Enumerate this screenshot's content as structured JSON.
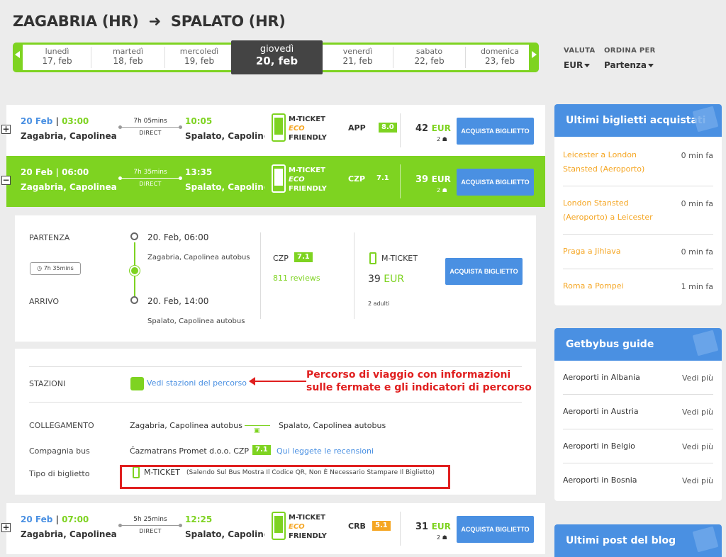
{
  "header": {
    "from": "ZAGABRIA (HR)",
    "arrow": "➜",
    "to": "SPALATO (HR)",
    "days": [
      {
        "name": "lunedì",
        "date": "17, feb"
      },
      {
        "name": "martedì",
        "date": "18, feb"
      },
      {
        "name": "mercoledì",
        "date": "19, feb"
      },
      {
        "name": "giovedì",
        "date": "20, feb",
        "active": true
      },
      {
        "name": "venerdì",
        "date": "21, feb"
      },
      {
        "name": "sabato",
        "date": "22, feb"
      },
      {
        "name": "domenica",
        "date": "23, feb"
      }
    ],
    "currency_label": "VALUTA",
    "currency_value": "EUR",
    "sort_label": "ORDINA PER",
    "sort_value": "Partenza"
  },
  "trips": [
    {
      "toggle": "+",
      "date": "20 Feb",
      "sep": " | ",
      "dep_time": "03:00",
      "dep_place": "Zagabria, Capolinea au...",
      "duration": "7h 05mins",
      "direct": "DIRECT",
      "arr_time": "10:05",
      "arr_place": "Spalato, Capolinea ...",
      "mticket": "M-TICKET",
      "eco": "ECO",
      "friendly": "FRIENDLY",
      "company": "APP",
      "rating": "8.0",
      "price": "42",
      "currency": "EUR",
      "pax": "2",
      "buy": "ACQUISTA BIGLIETTO"
    },
    {
      "toggle": "−",
      "date": "20 Feb",
      "sep": " | ",
      "dep_time": "06:00",
      "dep_place": "Zagabria, Capolinea au...",
      "duration": "7h 35mins",
      "direct": "DIRECT",
      "arr_time": "13:35",
      "arr_place": "Spalato, Capolinea ...",
      "mticket": "M-TICKET",
      "eco": "ECO",
      "friendly": "FRIENDLY",
      "company": "CZP",
      "rating": "7.1",
      "price": "39",
      "currency": "EUR",
      "pax": "2",
      "buy": "ACQUISTA BIGLIETTO"
    },
    {
      "toggle": "+",
      "date": "20 Feb",
      "sep": " | ",
      "dep_time": "07:00",
      "dep_place": "Zagabria, Capolinea au...",
      "duration": "5h 25mins",
      "direct": "DIRECT",
      "arr_time": "12:25",
      "arr_place": "Spalato, Capolinea ...",
      "mticket": "M-TICKET",
      "eco": "ECO",
      "friendly": "FRIENDLY",
      "company": "CRB",
      "rating": "5.1",
      "price": "31",
      "currency": "EUR",
      "pax": "2",
      "buy": "ACQUISTA BIGLIETTO"
    }
  ],
  "detail": {
    "partenza_label": "PARTENZA",
    "arrivo_label": "ARRIVO",
    "duration_badge": "7h 35mins",
    "dep_datetime": "20. Feb, 06:00",
    "dep_station": "Zagabria, Capolinea autobus",
    "arr_datetime": "20. Feb, 14:00",
    "arr_station": "Spalato, Capolinea autobus",
    "company": "CZP",
    "rating": "7.1",
    "reviews": "811 reviews",
    "mticket": "M-TICKET",
    "price": "39",
    "currency": "EUR",
    "adults": "2 adulti",
    "buy": "ACQUISTA BIGLIETTO",
    "stations_label": "STAZIONI",
    "stations_link": "Vedi stazioni del percorso",
    "connection_label": "COLLEGAMENTO",
    "connection_from": "Zagabria, Capolinea autobus",
    "connection_to": "Spalato, Capolinea autobus",
    "company_label": "Compagnia bus",
    "company_name": "Čazmatrans Promet d.o.o. CZP",
    "company_rating": "7.1",
    "reviews_link": "Qui leggete le recensioni",
    "ticket_type_label": "Tipo di biglietto",
    "ticket_type": "M-TICKET",
    "ticket_note": "(Salendo Sul Bus Mostra Il Codice QR, Non È Necessario Stampare Il Biglietto)"
  },
  "annotation": {
    "line1": "Percorso di viaggio con informazioni",
    "line2": "sulle fermate e gli indicatori di percorso"
  },
  "sidebar": {
    "recent_title": "Ultimi biglietti acquistati",
    "recent": [
      {
        "route": "Leicester a London Stansted (Aeroporto)",
        "time": "0 min fa"
      },
      {
        "route": "London Stansted (Aeroporto) a Leicester",
        "time": "0 min fa"
      },
      {
        "route": "Praga a Jihlava",
        "time": "0 min fa"
      },
      {
        "route": "Roma a Pompei",
        "time": "1 min fa"
      }
    ],
    "guide_title": "Getbybus guide",
    "guides": [
      {
        "name": "Aeroporti in Albania",
        "link": "Vedi più"
      },
      {
        "name": "Aeroporti in Austria",
        "link": "Vedi più"
      },
      {
        "name": "Aeroporti in Belgio",
        "link": "Vedi più"
      },
      {
        "name": "Aeroporti in Bosnia",
        "link": "Vedi più"
      }
    ],
    "blog_title": "Ultimi post del blog"
  },
  "colors": {
    "green": "#7ed321",
    "blue": "#4a90e2",
    "orange": "#f5a623",
    "red": "#e01f1f"
  }
}
